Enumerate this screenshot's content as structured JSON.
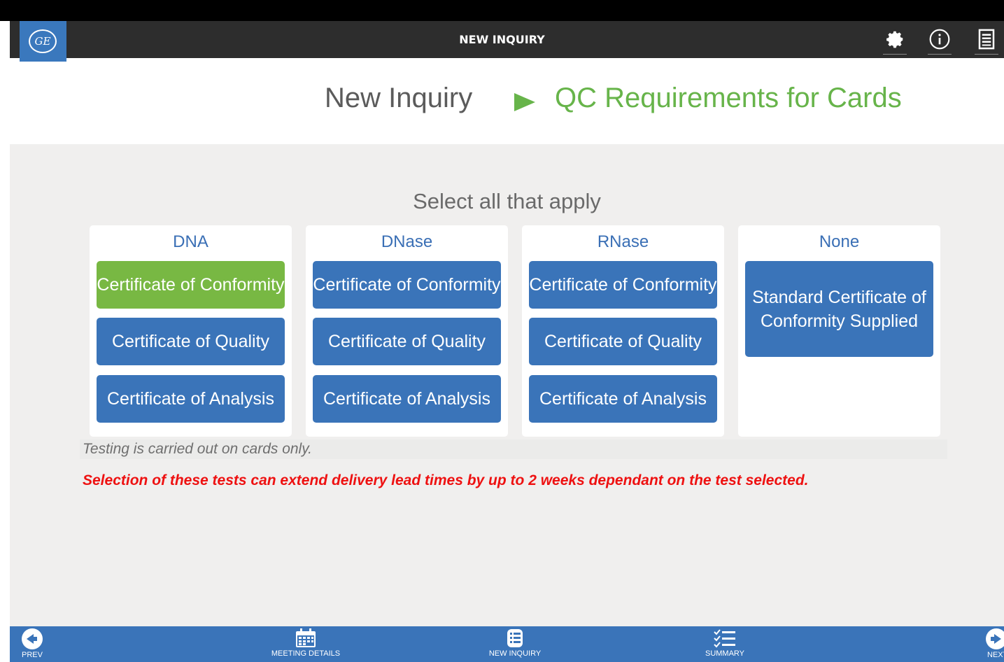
{
  "header": {
    "title": "NEW INQUIRY",
    "logo_text": "GE"
  },
  "breadcrumb": {
    "parent": "New Inquiry",
    "current": "QC Requirements for Cards"
  },
  "main": {
    "instruction": "Select all that apply",
    "columns": [
      {
        "title": "DNA",
        "options": [
          {
            "label": "Certificate of Conformity",
            "selected": true
          },
          {
            "label": "Certificate of Quality",
            "selected": false
          },
          {
            "label": "Certificate of Analysis",
            "selected": false
          }
        ]
      },
      {
        "title": "DNase",
        "options": [
          {
            "label": "Certificate of Conformity",
            "selected": false
          },
          {
            "label": "Certificate of Quality",
            "selected": false
          },
          {
            "label": "Certificate of Analysis",
            "selected": false
          }
        ]
      },
      {
        "title": "RNase",
        "options": [
          {
            "label": "Certificate of Conformity",
            "selected": false
          },
          {
            "label": "Certificate of Quality",
            "selected": false
          },
          {
            "label": "Certificate of Analysis",
            "selected": false
          }
        ]
      },
      {
        "title": "None",
        "options": [
          {
            "label": "Standard Certificate of Conformity Supplied",
            "selected": false
          }
        ]
      }
    ],
    "note": "Testing is carried out on cards only.",
    "warning": "Selection of these tests can extend delivery lead times by up to 2 weeks dependant on the test selected."
  },
  "bottom_nav": {
    "prev": "PREV",
    "meeting_details": "MEETING DETAILS",
    "new_inquiry": "NEW INQUIRY",
    "summary": "SUMMARY",
    "next": "NEXT"
  },
  "colors": {
    "header": "#2d2d2d",
    "accent_blue": "#3a74b9",
    "selected_green": "#78b843",
    "warning_red": "#ee1111"
  }
}
